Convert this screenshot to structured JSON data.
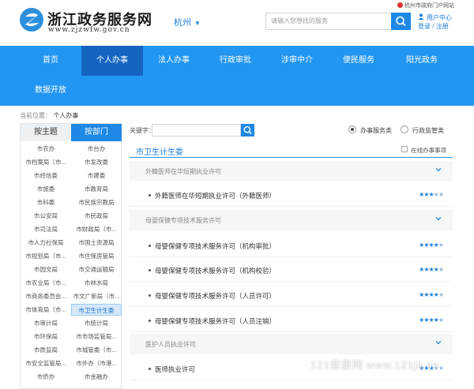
{
  "header": {
    "site_title": "浙江政务服务网",
    "site_url": "www.zjzwfw.gov.cn",
    "city": "杭州",
    "search_placeholder": "请输入您想找的服务",
    "top_notice": "杭州市政府门户网站",
    "user_center": "用户中心",
    "login": "登录",
    "separator": "/",
    "register": "注册",
    "brand_color": "#2196f3"
  },
  "nav": {
    "items": [
      {
        "label": "首页"
      },
      {
        "label": "个人办事"
      },
      {
        "label": "法人办事"
      },
      {
        "label": "行政审批"
      },
      {
        "label": "涉审中介"
      },
      {
        "label": "便民服务"
      },
      {
        "label": "阳光政务"
      },
      {
        "label": "数据开放"
      }
    ],
    "active": "个人办事"
  },
  "breadcrumb": {
    "prefix": "当前位置：",
    "current": "个人办事"
  },
  "left_panel": {
    "tabs": [
      {
        "label": "按主题"
      },
      {
        "label": "按部门"
      }
    ],
    "active_tab": "按部门",
    "departments": [
      [
        "市农办",
        "市台办"
      ],
      [
        "市档案局（市...",
        "市发改委"
      ],
      [
        "市经信委",
        "市建委"
      ],
      [
        "市旅委",
        "市教育局"
      ],
      [
        "市科委",
        "市民族宗教局"
      ],
      [
        "市公安局",
        "市民政局"
      ],
      [
        "市司法局",
        "市财政局（市..."
      ],
      [
        "市人力社保局",
        "市国土资源局"
      ],
      [
        "市规划局（市...",
        "市住保房管局"
      ],
      [
        "市园文局",
        "市交通运输局"
      ],
      [
        "市农业局（市...",
        "市林水局"
      ],
      [
        "市商务委员会...",
        "市文广新局（市..."
      ],
      [
        "市体育局（市...",
        "市卫生计生委"
      ],
      [
        "市审计局",
        "市统计局"
      ],
      [
        "市环保局",
        "市市场监管局..."
      ],
      [
        "市质监局",
        "市城管委（市..."
      ],
      [
        "市安全监管局...",
        "市外办（市港..."
      ],
      [
        "市侨办",
        "市金融办"
      ]
    ],
    "selected": "市卫生计生委"
  },
  "search_bar": {
    "keyword_label": "关键字：",
    "radio_options": [
      {
        "label": "办事服务类"
      },
      {
        "label": "行政监管类"
      }
    ],
    "radio_selected": "办事服务类"
  },
  "content": {
    "section_title": "市卫生计生委",
    "online_only_label": "在线办事事项",
    "groups": [
      {
        "label": "外籍医师在华短期执业许可",
        "items": [
          {
            "label": "外籍医师在华短期执业许可（外籍医师）",
            "rating": 3,
            "max": 5
          }
        ]
      },
      {
        "label": "母婴保健专项技术服务许可",
        "items": [
          {
            "label": "母婴保健专项技术服务许可（机构审批）",
            "rating": 4,
            "max": 5
          },
          {
            "label": "母婴保健专项技术服务许可（机构校验）",
            "rating": 4,
            "max": 5
          },
          {
            "label": "母婴保健专项技术服务许可（人员许可）",
            "rating": 4,
            "max": 5
          },
          {
            "label": "母婴保健专项技术服务许可（人员注销）",
            "rating": 4,
            "max": 5
          }
        ]
      },
      {
        "label": "医护人员执业许可",
        "items": [
          {
            "label": "医师执业许可",
            "rating": 3,
            "max": 5
          }
        ]
      }
    ]
  },
  "watermark": "121健康网 www.121jk.cn"
}
